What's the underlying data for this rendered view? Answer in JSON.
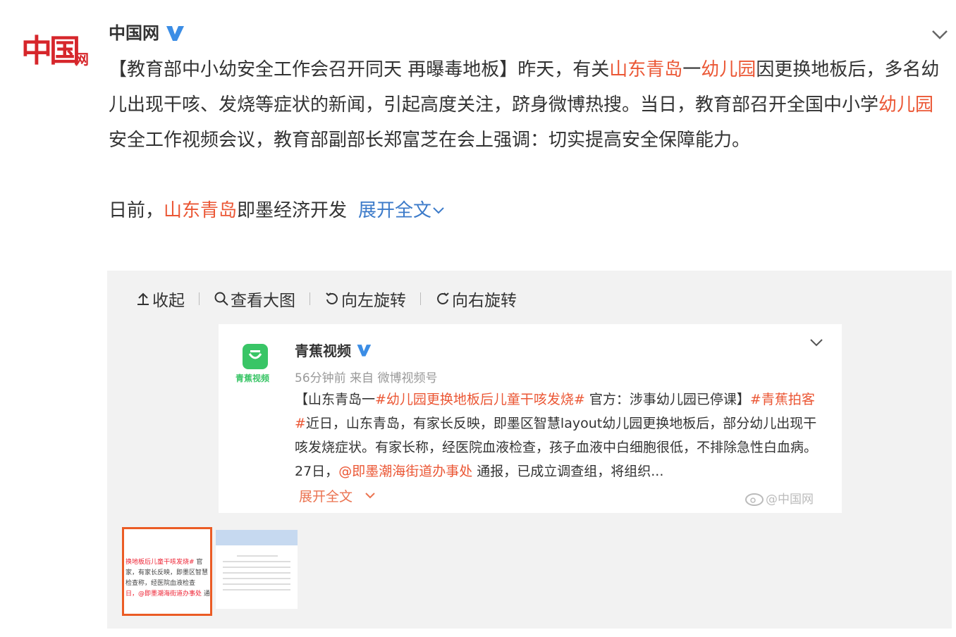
{
  "post": {
    "logo_text": "中国",
    "logo_sub": "网",
    "author": "中国网",
    "verified_icon": "verified-v-icon",
    "menu_icon": "chevron-down-icon",
    "para1_a": "【教育部中小幼安全工作会召开同天 再曝毒地板】昨天，有关",
    "para1_hl1": "山东青岛",
    "para1_b": "一",
    "para1_hl2": "幼儿园",
    "para1_c": "因更换地板后，多名幼儿出现干咳、发烧等症状的新闻，引起高度关注，跻身微博热搜。当日，教育部召开全国中小学",
    "para1_hl3": "幼儿园",
    "para1_d": "安全工作视频会议，教育部副部长郑富芝在会上强调：切实提高安全保障能力。",
    "para2_a": "日前，",
    "para2_hl": "山东青岛",
    "para2_b": "即墨经济开发",
    "expand": "展开全文",
    "highlight_color": "#eb5735",
    "link_color": "#3b7ac9"
  },
  "toolbar": {
    "collapse": "收起",
    "view_large": "查看大图",
    "rotate_left": "向左旋转",
    "rotate_right": "向右旋转"
  },
  "embedded": {
    "account": "青蕉视频",
    "logo_label": "青蕉视频",
    "meta": "56分钟前 来自 微博视频号",
    "line1_a": "【山东青岛一",
    "line1_hl": "#幼儿园更换地板后儿童干咳发烧#",
    "line1_b": " 官方：涉事幼儿园已停课】",
    "line1_hl2": "#青蕉拍客#",
    "line2": "近日，山东青岛，有家长反映，即墨区智慧layout幼儿园更换地板后，部分幼儿出现干咳发烧症状。有家长称，经医院血液检查，孩子血液中白细胞很低，不排除急性白血病。27日，",
    "line2_hl": "@即墨潮海街道办事处",
    "line2_b": " 通报，已成立调查组，将组织...",
    "expand": "展开全文",
    "watermark": "@中国网"
  },
  "thumbs": {
    "t1_lines": [
      {
        "r": "换地板后儿童干咳发烧#",
        "n": " 官"
      },
      {
        "r": "",
        "n": "家，有家长反映，即墨区智慧"
      },
      {
        "r": "",
        "n": "检查称，经医院血液检查"
      },
      {
        "r": "日，@即墨潮海街道办事处",
        "n": " 通"
      }
    ]
  }
}
